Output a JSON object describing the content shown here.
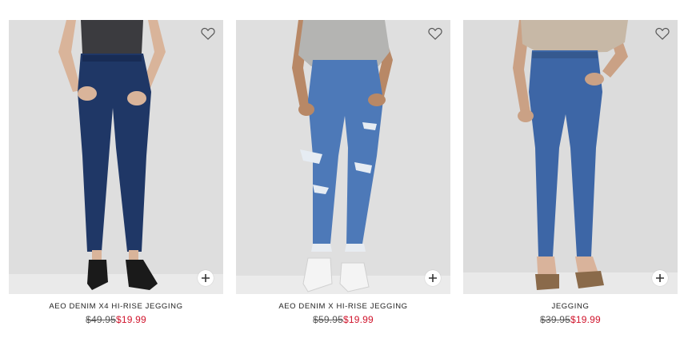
{
  "products": [
    {
      "name": "AEO DENIM X4 HI-RISE JEGGING",
      "list_price": "$49.95",
      "sale_price": "$19.99",
      "wishlist_icon": "heart-outline-icon",
      "quick_add_icon": "plus-icon",
      "colors": {
        "denim": "#1f3766",
        "top": "#3b3b3f",
        "shoe": "#1a1a1a"
      }
    },
    {
      "name": "AEO DENIM X HI-RISE JEGGING",
      "list_price": "$59.95",
      "sale_price": "$19.99",
      "wishlist_icon": "heart-outline-icon",
      "quick_add_icon": "plus-icon",
      "colors": {
        "denim": "#4d79b8",
        "top": "#b4b4b2",
        "shoe": "#f4f4f4"
      }
    },
    {
      "name": "JEGGING",
      "list_price": "$39.95",
      "sale_price": "$19.99",
      "wishlist_icon": "heart-outline-icon",
      "quick_add_icon": "plus-icon",
      "colors": {
        "denim": "#3d66a6",
        "top": "#c7b8a6",
        "shoe": "#8a6a4a"
      }
    }
  ],
  "colors": {
    "sale_price": "#d0142c",
    "list_price": "#555555",
    "name_text": "#222222"
  }
}
